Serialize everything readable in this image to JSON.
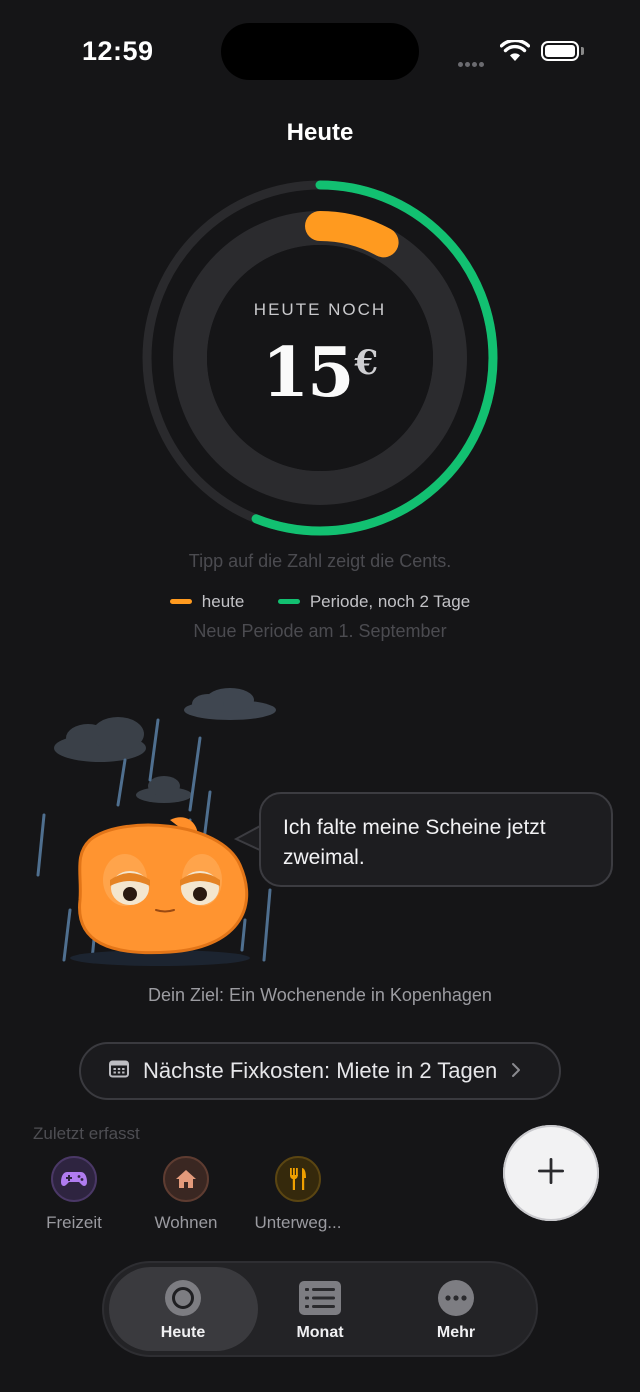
{
  "status_bar": {
    "time": "12:59"
  },
  "header": {
    "title": "Heute"
  },
  "budget": {
    "caption": "HEUTE NOCH",
    "amount": "15",
    "currency": "€",
    "period_progress": 0.56,
    "today_progress": 0.08,
    "colors": {
      "today": "#FF9A1F",
      "period": "#12C071"
    }
  },
  "tip": "Tipp auf die Zahl zeigt die Cents.",
  "legend": {
    "today_label": "heute",
    "period_label": "Periode, noch 2 Tage"
  },
  "next_period": "Neue Periode am 1. September",
  "mascot": {
    "speech": "Ich falte meine Scheine jetzt zweimal."
  },
  "goal": "Dein Ziel: Ein Wochenende in Kopenhagen",
  "fixkosten": {
    "icon": "calendar-icon",
    "label": "Nächste Fixkosten: Miete in 2 Tagen"
  },
  "recent": {
    "title": "Zuletzt erfasst",
    "items": [
      {
        "label": "Freizeit",
        "icon": "gamepad-icon",
        "color": "#B07CF0"
      },
      {
        "label": "Wohnen",
        "icon": "house-icon",
        "color": "#E39A7B"
      },
      {
        "label": "Unterweg...",
        "icon": "fork-knife-icon",
        "color": "#F0A000"
      }
    ]
  },
  "tabs": [
    {
      "label": "Heute",
      "icon": "circle-icon",
      "active": true
    },
    {
      "label": "Monat",
      "icon": "list-icon",
      "active": false
    },
    {
      "label": "Mehr",
      "icon": "more-icon",
      "active": false
    }
  ]
}
